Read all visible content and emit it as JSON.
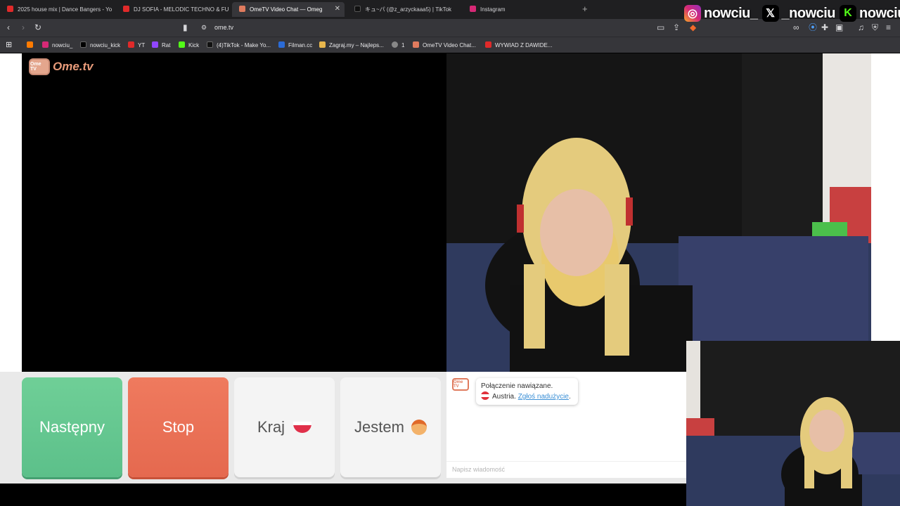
{
  "tabs": [
    {
      "title": "2025 house mix | Dance Bangers - Yo",
      "favicon_color": "#e02a2a"
    },
    {
      "title": "DJ SOFIA - MELODIC TECHNO & FU",
      "favicon_color": "#e02a2a"
    },
    {
      "title": "OmeTV Video Chat — Omeg",
      "favicon_color": "#e07b5e",
      "active": true
    },
    {
      "title": "キュ~パ (@z_arzyckaaa5) | TikTok",
      "favicon_color": "#111111"
    },
    {
      "title": "Instagram",
      "favicon_color": "#d62976"
    }
  ],
  "social": [
    {
      "icon": "instagram-icon",
      "handle": "nowciu_",
      "color": "#d62976"
    },
    {
      "icon": "x-icon",
      "handle": "_nowciu",
      "color": "#000000"
    },
    {
      "icon": "kick-icon",
      "handle": "nowciu",
      "color": "#53fc18"
    }
  ],
  "address": {
    "url": "ome.tv"
  },
  "bookmarks": [
    {
      "label": "",
      "color": "#ff7b00"
    },
    {
      "label": "nowciu_",
      "color": "#d62976"
    },
    {
      "label": "nowciu_kick",
      "color": "#000000"
    },
    {
      "label": "YT",
      "color": "#e02a2a"
    },
    {
      "label": "Rat",
      "color": "#9146ff"
    },
    {
      "label": "Kick",
      "color": "#53fc18"
    },
    {
      "label": "(4)TikTok - Make Yo...",
      "color": "#111111"
    },
    {
      "label": "Filman.cc",
      "color": "#2b6bd6"
    },
    {
      "label": "Zagraj.my – Najleps...",
      "color": "#e8b64c"
    },
    {
      "label": "1",
      "color": "#888888"
    },
    {
      "label": "OmeTV Video Chat...",
      "color": "#e07b5e"
    },
    {
      "label": "WYWIAD Z DAWIDE...",
      "color": "#e02a2a"
    }
  ],
  "brand": {
    "logo_text": "Ome.tv",
    "logo_badge": "Ome TV",
    "accent": "#e89b7a"
  },
  "controls": {
    "next_label": "Następny",
    "stop_label": "Stop",
    "country_label": "Kraj",
    "gender_label": "Jestem",
    "next_color": "#6fcf97",
    "stop_color": "#e5694f"
  },
  "chat": {
    "line1": "Połączenie nawiązane.",
    "country": "Austria.",
    "report_link": "Zgłoś nadużycie",
    "placeholder": "Napisz wiadomość"
  }
}
